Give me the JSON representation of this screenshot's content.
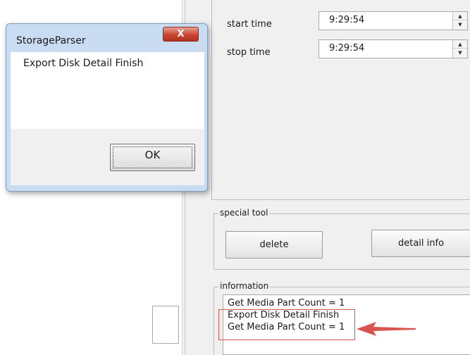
{
  "time_settings": {
    "start_label": "start time",
    "start_value": "9:29:54",
    "stop_label": "stop time",
    "stop_value": "9:29:54",
    "spin_up": "▲",
    "spin_down": "▼"
  },
  "special_tool": {
    "title": "special tool",
    "delete_label": "delete",
    "detail_info_label": "detail info"
  },
  "information": {
    "title": "information",
    "lines": [
      "Get Media Part Count = 1",
      "Export Disk Detail Finish",
      "Get Media Part Count = 1"
    ]
  },
  "dialog": {
    "title": "StorageParser",
    "close_label": "X",
    "message": "Export Disk Detail Finish",
    "ok_label": "OK"
  },
  "colors": {
    "annotation_red": "#d9534f",
    "dialog_frame": "#c9dcf2",
    "close_button": "#c9442f"
  }
}
